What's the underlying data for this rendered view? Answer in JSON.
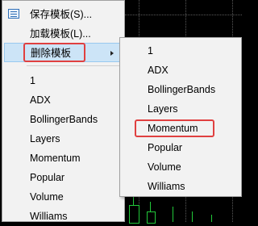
{
  "menu": {
    "save_template": "保存模板(S)...",
    "load_template": "加载模板(L)...",
    "delete_template": "删除模板",
    "templates": [
      "1",
      "ADX",
      "BollingerBands",
      "Layers",
      "Momentum",
      "Popular",
      "Volume",
      "Williams"
    ]
  },
  "submenu": {
    "items": [
      "1",
      "ADX",
      "BollingerBands",
      "Layers",
      "Momentum",
      "Popular",
      "Volume",
      "Williams"
    ],
    "highlighted_item": "Momentum"
  },
  "colors": {
    "menu_bg": "#f2f2f2",
    "hover_bg": "#cce4f7",
    "annotation_red": "#e04040",
    "chart_bg": "#000000",
    "candle_green": "#22c83a"
  }
}
